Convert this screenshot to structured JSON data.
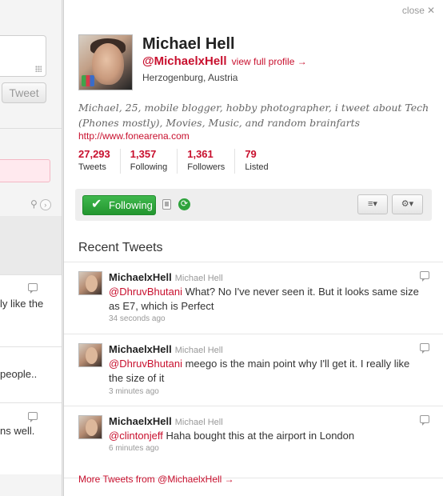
{
  "left_column": {
    "tweet_button": "Tweet",
    "snippets": [
      "ly like the",
      "people..",
      "ns well."
    ]
  },
  "panel": {
    "close_label": "close",
    "close_glyph": "✕",
    "profile": {
      "name": "Michael Hell",
      "screen_name": "@MichaelxHell",
      "view_full_profile": "view full profile →",
      "location": "Herzogenburg, Austria",
      "bio": "Michael, 25, mobile blogger, hobby photographer, i tweet about Tech (Phones mostly), Movies, Music, and random brainfarts",
      "url": "http://www.fonearena.com",
      "stats": [
        {
          "value": "27,293",
          "label": "Tweets"
        },
        {
          "value": "1,357",
          "label": "Following"
        },
        {
          "value": "1,361",
          "label": "Followers"
        },
        {
          "value": "79",
          "label": "Listed"
        }
      ]
    },
    "actions": {
      "follow_label": "Following",
      "list_menu_glyph": "≡▾",
      "gear_menu_glyph": "⚙▾",
      "accent_green": "#2ea33c"
    },
    "recent_title": "Recent Tweets",
    "tweets": [
      {
        "user": "MichaelxHell",
        "full_name": "Michael Hell",
        "mention": "@DhruvBhutani",
        "text": " What? No I've never seen it. But it looks same size as E7, which is Perfect",
        "time": "34 seconds ago"
      },
      {
        "user": "MichaelxHell",
        "full_name": "Michael Hell",
        "mention": "@DhruvBhutani",
        "text": " meego is the main point why I'll get it. I really like the size of it",
        "time": "3 minutes ago"
      },
      {
        "user": "MichaelxHell",
        "full_name": "Michael Hell",
        "mention": "@clintonjeff",
        "text": " Haha bought this at the airport in London",
        "time": "6 minutes ago"
      }
    ],
    "more_tweets": "More Tweets from @MichaelxHell →",
    "accent_red": "#c8102e"
  }
}
